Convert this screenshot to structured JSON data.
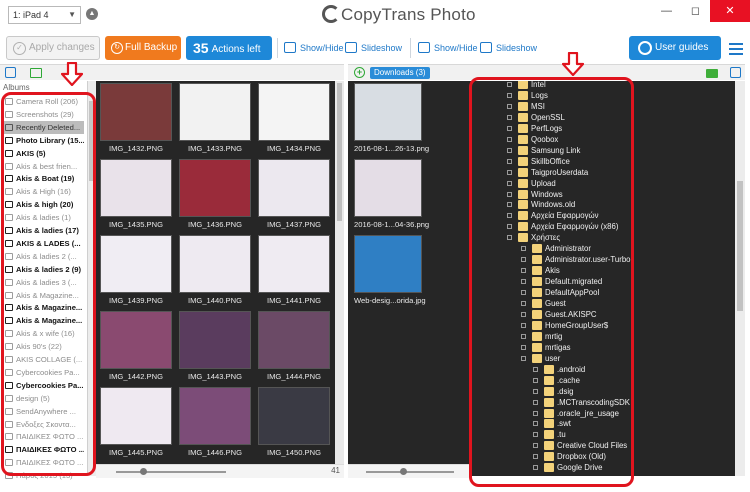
{
  "device": {
    "selected": "1: iPad 4"
  },
  "app_title": "CopyTrans Photo",
  "toolbar": {
    "apply": "Apply changes",
    "backup": "Full Backup",
    "actions_count": "35",
    "actions_label": "Actions left",
    "show_hide": "Show/Hide",
    "slideshow": "Slideshow",
    "guides": "User guides"
  },
  "sidebar": {
    "title": "Albums",
    "items": [
      {
        "label": "Camera Roll (206)",
        "style": "dim"
      },
      {
        "label": "Screenshots (29)",
        "style": "dim"
      },
      {
        "label": "Recently Deleted...",
        "style": "sel"
      },
      {
        "label": "Photo Library (15...",
        "style": "bold"
      },
      {
        "label": "AKIS (5)",
        "style": "bold"
      },
      {
        "label": "Akis & best frien...",
        "style": "dim"
      },
      {
        "label": "Akis & Boat (19)",
        "style": "bold"
      },
      {
        "label": "Akis & High (16)",
        "style": "dim"
      },
      {
        "label": "Akis & high (20)",
        "style": "bold"
      },
      {
        "label": "Akis & ladies (1)",
        "style": "dim"
      },
      {
        "label": "Akis & ladies (17)",
        "style": "bold"
      },
      {
        "label": "AKIS & LADES (...",
        "style": "bold"
      },
      {
        "label": "Akis & ladies 2 (...",
        "style": "dim"
      },
      {
        "label": "Akis & ladies 2 (9)",
        "style": "bold"
      },
      {
        "label": "Akis & ladies 3 (...",
        "style": "dim"
      },
      {
        "label": "Akis & Magazine...",
        "style": "dim"
      },
      {
        "label": "Akis & Magazine...",
        "style": "bold"
      },
      {
        "label": "Akis & Magazine...",
        "style": "bold"
      },
      {
        "label": "Akis & x wife (16)",
        "style": "dim"
      },
      {
        "label": "Akis 90's (22)",
        "style": "dim"
      },
      {
        "label": "AKIS COLLAGE (...",
        "style": "dim"
      },
      {
        "label": "Cybercookies Pa...",
        "style": "dim"
      },
      {
        "label": "Cybercookies Pa...",
        "style": "bold"
      },
      {
        "label": "design (5)",
        "style": "dim"
      },
      {
        "label": "SendAnywhere ...",
        "style": "dim"
      },
      {
        "label": "Ενδοξες Σκοντα...",
        "style": "dim"
      },
      {
        "label": "ΠΑΙΔΙΚΕΣ ΦΩΤΟ ...",
        "style": "dim"
      },
      {
        "label": "ΠΑΙΔΙΚΕΣ ΦΩΤΟ ...",
        "style": "bold"
      },
      {
        "label": "ΠΑΙΔΙΚΕΣ ΦΩΤΟ ...",
        "style": "dim"
      },
      {
        "label": "Πάρος 2015 (13)",
        "style": "dim"
      }
    ]
  },
  "photos": [
    {
      "label": "IMG_1432.PNG",
      "color": "#7a3a3a"
    },
    {
      "label": "IMG_1433.PNG",
      "color": "#f2f2f2"
    },
    {
      "label": "IMG_1434.PNG",
      "color": "#f4f4f4"
    },
    {
      "label": "IMG_1435.PNG",
      "color": "#e9e2ea"
    },
    {
      "label": "IMG_1436.PNG",
      "color": "#9a2b3a"
    },
    {
      "label": "IMG_1437.PNG",
      "color": "#ece8ef"
    },
    {
      "label": "IMG_1439.PNG",
      "color": "#f0edf3"
    },
    {
      "label": "IMG_1440.PNG",
      "color": "#eeeaf1"
    },
    {
      "label": "IMG_1441.PNG",
      "color": "#efebf2"
    },
    {
      "label": "IMG_1442.PNG",
      "color": "#8a4a70"
    },
    {
      "label": "IMG_1443.PNG",
      "color": "#5a3c5e"
    },
    {
      "label": "IMG_1444.PNG",
      "color": "#6b4a66"
    },
    {
      "label": "IMG_1445.PNG",
      "color": "#efe9f1"
    },
    {
      "label": "IMG_1446.PNG",
      "color": "#7c4c78"
    },
    {
      "label": "IMG_1450.PNG",
      "color": "#3a3a44"
    }
  ],
  "photo_count": "41",
  "pc": {
    "folder_badge": "Downloads (3)",
    "files": [
      {
        "label": "2016-08-1...26-13.png",
        "color": "#d8dde3"
      },
      {
        "label": "2016-08-1...04-36.png",
        "color": "#e4dde6"
      },
      {
        "label": "Web-desig...orida.jpg",
        "color": "#2f7fc4"
      }
    ],
    "tree": [
      {
        "label": "Intel",
        "level": 0
      },
      {
        "label": "Logs",
        "level": 0
      },
      {
        "label": "MSI",
        "level": 0
      },
      {
        "label": "OpenSSL",
        "level": 0
      },
      {
        "label": "PerfLogs",
        "level": 0
      },
      {
        "label": "Qoobox",
        "level": 0
      },
      {
        "label": "Samsung Link",
        "level": 0
      },
      {
        "label": "SkillbOffice",
        "level": 0
      },
      {
        "label": "TaigproUserdata",
        "level": 0
      },
      {
        "label": "Upload",
        "level": 0
      },
      {
        "label": "Windows",
        "level": 0
      },
      {
        "label": "Windows.old",
        "level": 0
      },
      {
        "label": "Αρχεία Εφαρμογών",
        "level": 0
      },
      {
        "label": "Αρχεία Εφαρμογών (x86)",
        "level": 0
      },
      {
        "label": "Χρήστες",
        "level": 0
      },
      {
        "label": "Administrator",
        "level": 1
      },
      {
        "label": "Administrator.user-Turbo",
        "level": 1
      },
      {
        "label": "Akis",
        "level": 1
      },
      {
        "label": "Default.migrated",
        "level": 1
      },
      {
        "label": "DefaultAppPool",
        "level": 1
      },
      {
        "label": "Guest",
        "level": 1
      },
      {
        "label": "Guest.AKISPC",
        "level": 1
      },
      {
        "label": "HomeGroupUser$",
        "level": 1
      },
      {
        "label": "mrtig",
        "level": 1
      },
      {
        "label": "mrtigas",
        "level": 1
      },
      {
        "label": "user",
        "level": 1
      },
      {
        "label": ".android",
        "level": 2
      },
      {
        "label": ".cache",
        "level": 2
      },
      {
        "label": ".dsig",
        "level": 2
      },
      {
        "label": ".MCTranscodingSDK",
        "level": 2
      },
      {
        "label": ".oracle_jre_usage",
        "level": 2
      },
      {
        "label": ".swt",
        "level": 2
      },
      {
        "label": ".tu",
        "level": 2
      },
      {
        "label": "Creative Cloud Files",
        "level": 2
      },
      {
        "label": "Dropbox (Old)",
        "level": 2
      },
      {
        "label": "Google Drive",
        "level": 2
      }
    ]
  }
}
